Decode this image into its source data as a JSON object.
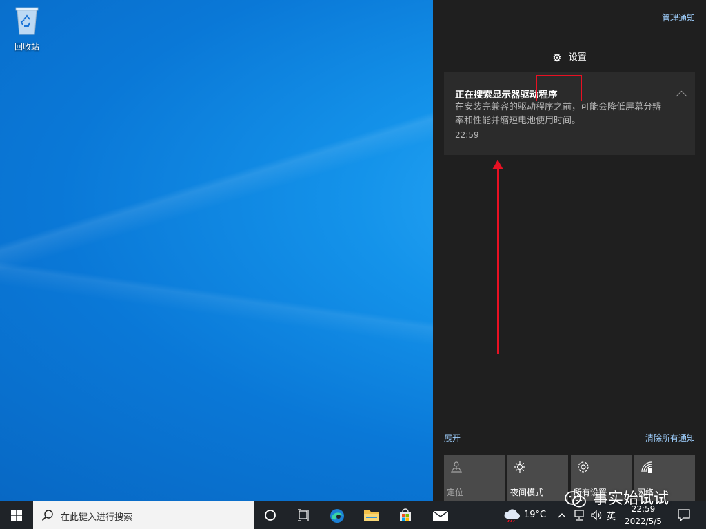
{
  "desktop": {
    "icons": [
      {
        "label": "回收站",
        "icon": "recycle-bin-icon"
      }
    ]
  },
  "action_center": {
    "manage_label": "管理通知",
    "settings_label": "设置",
    "notification": {
      "title": "正在搜索显示器驱动程序",
      "body": "在安装完兼容的驱动程序之前，可能会降低屏幕分辨率和性能并缩短电池使用时间。",
      "time": "22:59"
    },
    "expand_label": "展开",
    "clear_label": "清除所有通知",
    "tiles": [
      {
        "label": "定位",
        "icon": "location-icon",
        "active": false
      },
      {
        "label": "夜间模式",
        "icon": "night-light-icon",
        "active": true
      },
      {
        "label": "所有设置",
        "icon": "settings-icon",
        "active": true
      },
      {
        "label": "网络",
        "icon": "network-icon",
        "active": true
      }
    ]
  },
  "taskbar": {
    "search_placeholder": "在此键入进行搜索",
    "pinned": [
      "cortana-icon",
      "task-view-icon",
      "edge-icon",
      "file-explorer-icon",
      "store-icon",
      "mail-icon"
    ],
    "weather_temp": "19°C",
    "ime_label": "英",
    "time": "22:59",
    "date": "2022/5/5"
  },
  "watermark": {
    "text": "事实始试试"
  },
  "colors": {
    "accent_link": "#9fd0ff",
    "annotation_red": "#e81123",
    "panel_bg": "#1f1f1f"
  }
}
